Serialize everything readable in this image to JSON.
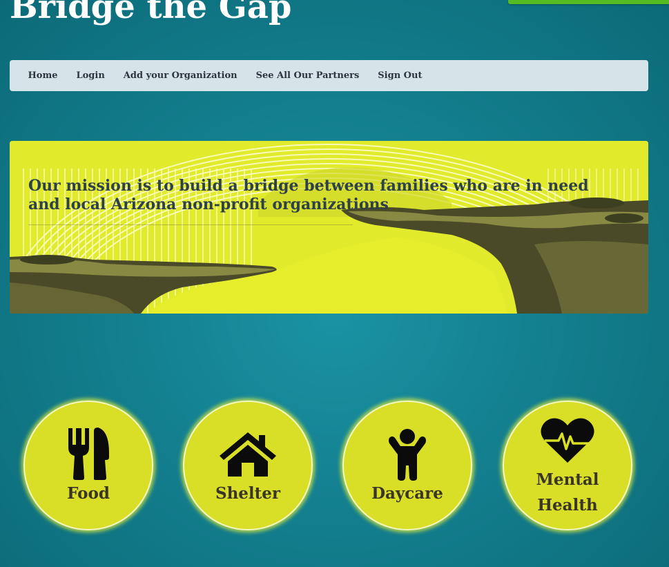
{
  "site": {
    "title": "Bridge the Gap"
  },
  "nav": {
    "items": [
      {
        "label": "Home"
      },
      {
        "label": "Login"
      },
      {
        "label": "Add your Organization"
      },
      {
        "label": "See All Our Partners"
      },
      {
        "label": "Sign Out"
      }
    ]
  },
  "hero": {
    "mission": "Our mission is to build a bridge between families who are in need and local Arizona non-profit organizations"
  },
  "services": [
    {
      "label": "Food",
      "icon": "fork-knife-icon"
    },
    {
      "label": "Shelter",
      "icon": "house-icon"
    },
    {
      "label": "Daycare",
      "icon": "child-icon"
    },
    {
      "label": "Mental Health",
      "icon": "heartbeat-icon"
    }
  ],
  "colors": {
    "background": "#137f8f",
    "navbar": "#d6e4ea",
    "accent_yellow": "#d8df26",
    "top_strip": "#55bb22",
    "text_dark": "#2e4048"
  }
}
